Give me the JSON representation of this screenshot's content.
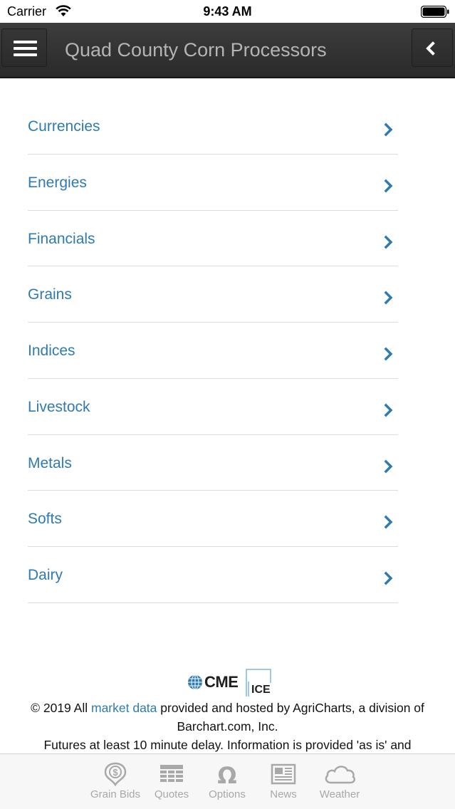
{
  "status_bar": {
    "carrier": "Carrier",
    "time": "9:43 AM"
  },
  "header": {
    "title": "Quad County Corn Processors"
  },
  "categories": [
    {
      "label": "Currencies"
    },
    {
      "label": "Energies"
    },
    {
      "label": "Financials"
    },
    {
      "label": "Grains"
    },
    {
      "label": "Indices"
    },
    {
      "label": "Livestock"
    },
    {
      "label": "Metals"
    },
    {
      "label": "Softs"
    },
    {
      "label": "Dairy"
    }
  ],
  "footer": {
    "cme_logo": "CME",
    "ice_logo": "ICE",
    "copyright_before": "© 2019 All ",
    "copyright_link": "market data",
    "copyright_after": " provided and hosted by AgriCharts, a division of Barchart.com, Inc.",
    "delay_notice": "Futures at least 10 minute delay. Information is provided 'as is' and"
  },
  "tabs": [
    {
      "label": "Grain Bids",
      "icon": "dollar-badge-icon"
    },
    {
      "label": "Quotes",
      "icon": "table-icon"
    },
    {
      "label": "Options",
      "icon": "omega-icon"
    },
    {
      "label": "News",
      "icon": "newspaper-icon"
    },
    {
      "label": "Weather",
      "icon": "cloud-icon"
    }
  ],
  "colors": {
    "accent": "#2f7bb1",
    "header_bg": "#333333",
    "tab_icon": "#a8a8a8"
  }
}
